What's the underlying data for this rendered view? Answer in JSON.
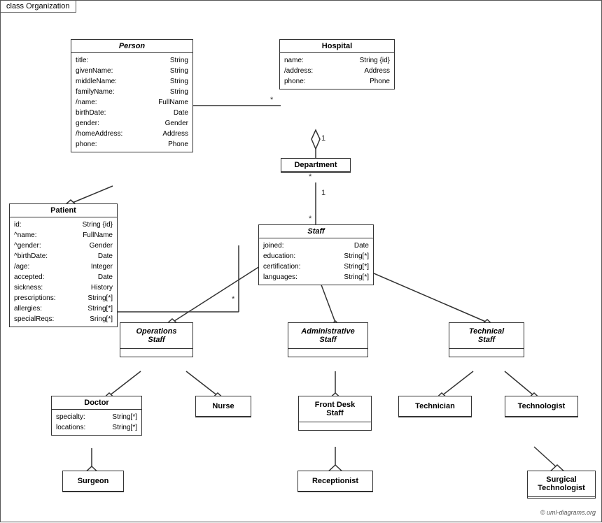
{
  "diagram": {
    "label": "class Organization",
    "copyright": "© uml-diagrams.org",
    "classes": {
      "person": {
        "title": "Person",
        "italic": true,
        "attrs": [
          [
            "title:",
            "String"
          ],
          [
            "givenName:",
            "String"
          ],
          [
            "middleName:",
            "String"
          ],
          [
            "familyName:",
            "String"
          ],
          [
            "/name:",
            "FullName"
          ],
          [
            "birthDate:",
            "Date"
          ],
          [
            "gender:",
            "Gender"
          ],
          [
            "/homeAddress:",
            "Address"
          ],
          [
            "phone:",
            "Phone"
          ]
        ]
      },
      "hospital": {
        "title": "Hospital",
        "italic": false,
        "attrs": [
          [
            "name:",
            "String {id}"
          ],
          [
            "/address:",
            "Address"
          ],
          [
            "phone:",
            "Phone"
          ]
        ]
      },
      "patient": {
        "title": "Patient",
        "italic": false,
        "attrs": [
          [
            "id:",
            "String {id}"
          ],
          [
            "^name:",
            "FullName"
          ],
          [
            "^gender:",
            "Gender"
          ],
          [
            "^birthDate:",
            "Date"
          ],
          [
            "/age:",
            "Integer"
          ],
          [
            "accepted:",
            "Date"
          ],
          [
            "sickness:",
            "History"
          ],
          [
            "prescriptions:",
            "String[*]"
          ],
          [
            "allergies:",
            "String[*]"
          ],
          [
            "specialReqs:",
            "Sring[*]"
          ]
        ]
      },
      "department": {
        "title": "Department",
        "italic": false,
        "attrs": []
      },
      "staff": {
        "title": "Staff",
        "italic": true,
        "attrs": [
          [
            "joined:",
            "Date"
          ],
          [
            "education:",
            "String[*]"
          ],
          [
            "certification:",
            "String[*]"
          ],
          [
            "languages:",
            "String[*]"
          ]
        ]
      },
      "operations_staff": {
        "title": "Operations\nStaff",
        "italic": true,
        "attrs": []
      },
      "administrative_staff": {
        "title": "Administrative\nStaff",
        "italic": true,
        "attrs": []
      },
      "technical_staff": {
        "title": "Technical\nStaff",
        "italic": true,
        "attrs": []
      },
      "doctor": {
        "title": "Doctor",
        "italic": false,
        "attrs": [
          [
            "specialty:",
            "String[*]"
          ],
          [
            "locations:",
            "String[*]"
          ]
        ]
      },
      "nurse": {
        "title": "Nurse",
        "italic": false,
        "attrs": []
      },
      "front_desk_staff": {
        "title": "Front Desk\nStaff",
        "italic": false,
        "attrs": []
      },
      "technician": {
        "title": "Technician",
        "italic": false,
        "attrs": []
      },
      "technologist": {
        "title": "Technologist",
        "italic": false,
        "attrs": []
      },
      "surgeon": {
        "title": "Surgeon",
        "italic": false,
        "attrs": []
      },
      "receptionist": {
        "title": "Receptionist",
        "italic": false,
        "attrs": []
      },
      "surgical_technologist": {
        "title": "Surgical\nTechnologist",
        "italic": false,
        "attrs": []
      }
    }
  }
}
